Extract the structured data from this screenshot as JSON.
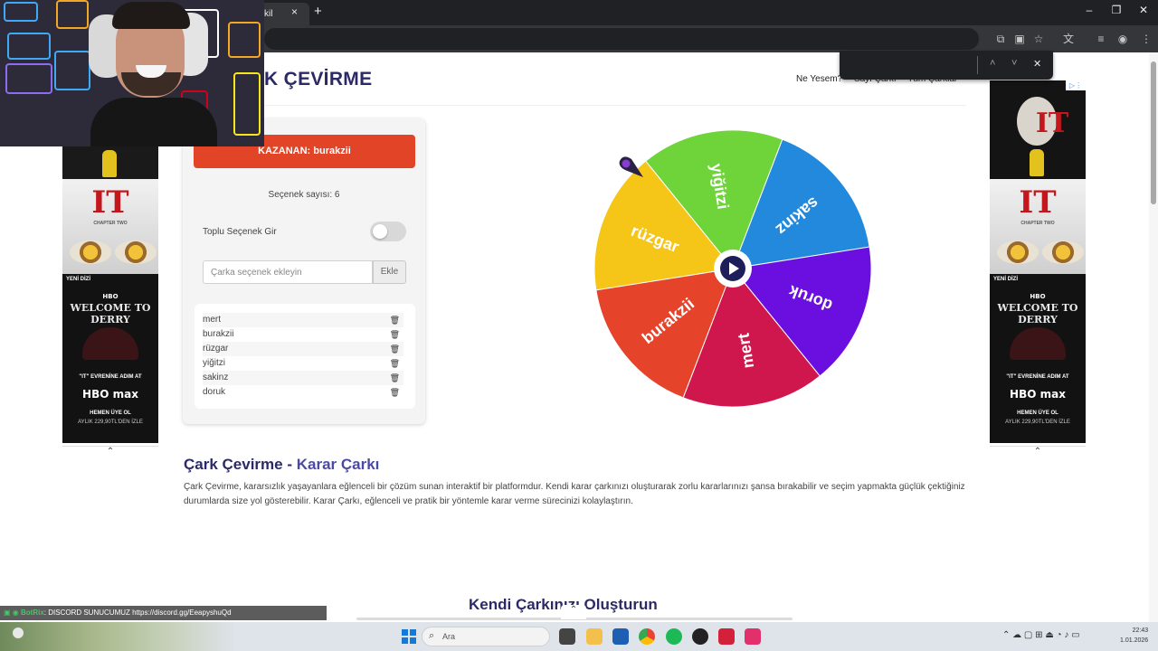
{
  "browser": {
    "tab_title": "kil",
    "tab_close": "×",
    "new_tab": "+"
  },
  "findbar": {
    "up": "˄",
    "down": "˅",
    "close": "✕"
  },
  "site": {
    "title": "K ÇEVİRME",
    "nav": [
      "Ne Yesem?",
      "Sayı Çarkı",
      "Tüm Çarklar"
    ]
  },
  "panel": {
    "winner_label": "KAZANAN: burakzii",
    "count_label": "Seçenek sayısı: 6",
    "bulk_label": "Toplu Seçenek Gir",
    "input_placeholder": "Çarka seçenek ekleyin",
    "add_button": "Ekle",
    "options": [
      "mert",
      "burakzii",
      "rüzgar",
      "yiğitzi",
      "sakinz",
      "doruk"
    ]
  },
  "wheel": {
    "segments": [
      {
        "label": "rüzgar",
        "color": "#f5c518"
      },
      {
        "label": "yiğitzi",
        "color": "#6fd33a"
      },
      {
        "label": "sakinz",
        "color": "#2289dd"
      },
      {
        "label": "doruk",
        "color": "#6a0fe0"
      },
      {
        "label": "mert",
        "color": "#d0174d"
      },
      {
        "label": "burakzii",
        "color": "#e6432b"
      }
    ],
    "center_color": "#1e1e5a"
  },
  "section": {
    "title_main": "Çark Çevirme - ",
    "title_accent": "Karar Çarkı",
    "text": "Çark Çevirme, kararsızlık yaşayanlara eğlenceli bir çözüm sunan interaktif bir platformdur. Kendi karar çarkınızı oluşturarak zorlu kararlarınızı şansa bırakabilir ve seçim yapmakta güçlük çektiğiniz durumlarda size yol gösterebilir. Karar Çarkı, eğlenceli ve pratik bir yöntemle karar verme sürecinizi kolaylaştırın.",
    "title2": "Kendi Çarkınızı Oluşturun"
  },
  "ads": {
    "it_title": "IT",
    "chapter": "CHAPTER TWO",
    "yeni_dizi": "YENİ DİZİ",
    "welcome": "WELCOME TO DERRY",
    "promo": "\"IT\" EVRENİNE ADIM AT",
    "brand": "HBO max",
    "cta": "HEMEN ÜYE OL",
    "price": "AYLIK 229,90TL'DEN İZLE"
  },
  "chat": {
    "user": "BotRix",
    "message": ": DISCORD SUNUCUMUZ https://discord.gg/EeapyshuQd"
  },
  "taskbar": {
    "search_placeholder": "Ara",
    "clock_time": "22:43",
    "clock_date": "1.01.2026"
  }
}
